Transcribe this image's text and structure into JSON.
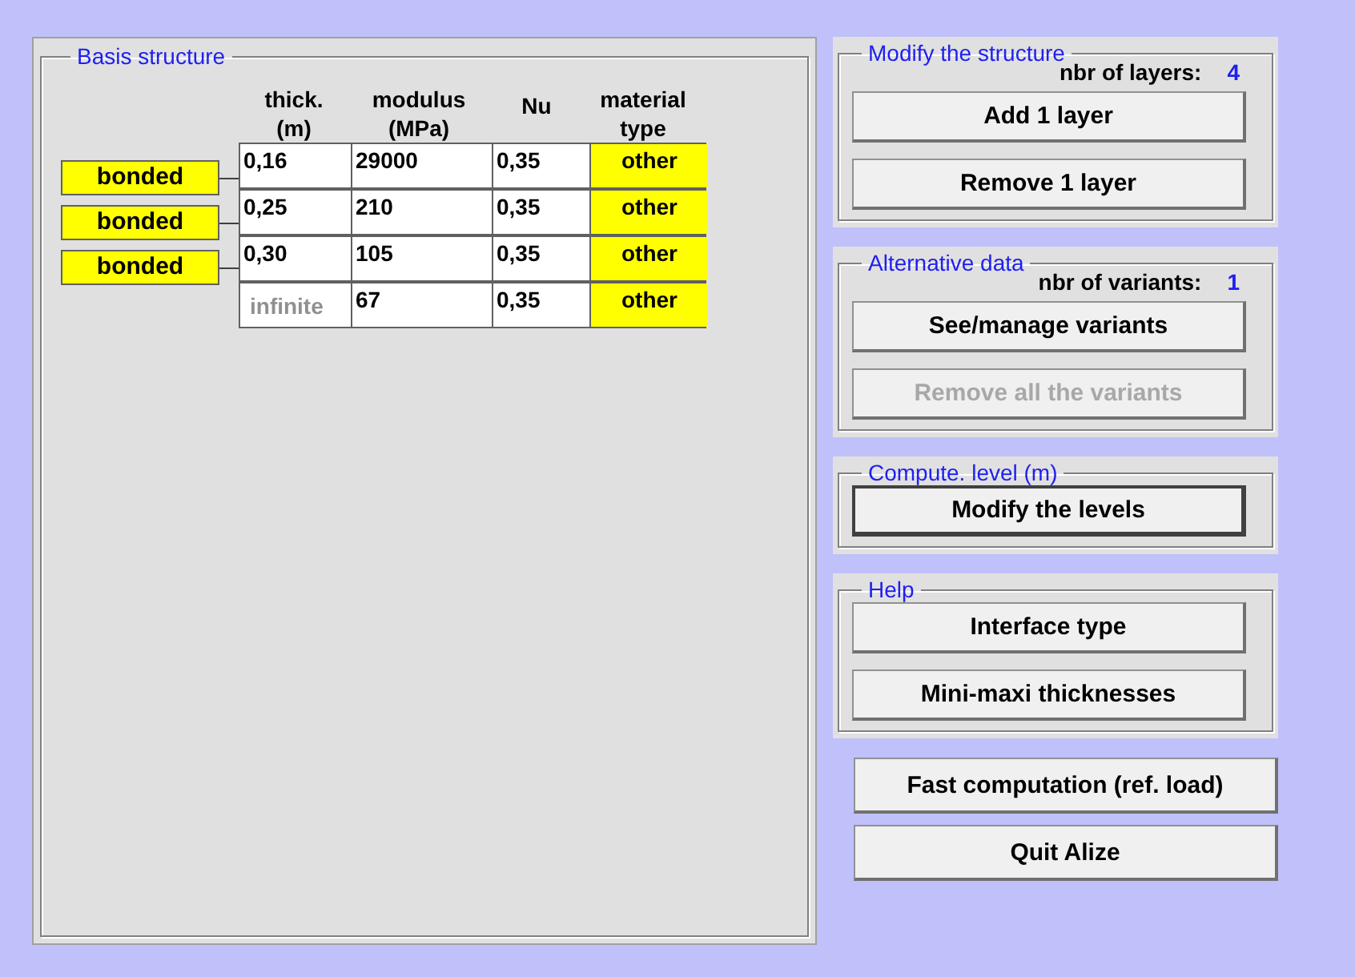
{
  "basis": {
    "title": "Basis structure",
    "columns": [
      {
        "line1": "thick.",
        "line2": "(m)"
      },
      {
        "line1": "modulus",
        "line2": "(MPa)"
      },
      {
        "line1": "Nu"
      },
      {
        "line1": "material",
        "line2": "type"
      }
    ],
    "layers": [
      {
        "thickness": "0,16",
        "thickness_greyed": false,
        "modulus": "29000",
        "nu": "0,35",
        "material": "other"
      },
      {
        "thickness": "0,25",
        "thickness_greyed": false,
        "modulus": "210",
        "nu": "0,35",
        "material": "other"
      },
      {
        "thickness": "0,30",
        "thickness_greyed": false,
        "modulus": "105",
        "nu": "0,35",
        "material": "other"
      },
      {
        "thickness": "infinite",
        "thickness_greyed": true,
        "modulus": "67",
        "nu": "0,35",
        "material": "other"
      }
    ],
    "interfaces": [
      "bonded",
      "bonded",
      "bonded"
    ]
  },
  "groups": [
    {
      "title": "Modify the structure",
      "count_label": "nbr of layers:",
      "count": "4",
      "buttons": [
        {
          "label": "Add 1 layer",
          "disabled": false
        },
        {
          "label": "Remove 1 layer",
          "disabled": false
        }
      ]
    },
    {
      "title": "Alternative data",
      "count_label": "nbr of variants:",
      "count": "1",
      "buttons": [
        {
          "label": "See/manage variants",
          "disabled": false
        },
        {
          "label": "Remove all the variants",
          "disabled": true
        }
      ]
    },
    {
      "title": "Compute. level (m)",
      "buttons": [
        {
          "label": "Modify the levels",
          "disabled": false
        }
      ]
    },
    {
      "title": "Help",
      "buttons": [
        {
          "label": "Interface type",
          "disabled": false
        },
        {
          "label": "Mini-maxi thicknesses",
          "disabled": false
        }
      ]
    }
  ],
  "actions": [
    {
      "label": "Fast computation (ref. load)",
      "disabled": false
    },
    {
      "label": "Quit Alize",
      "disabled": false
    }
  ]
}
